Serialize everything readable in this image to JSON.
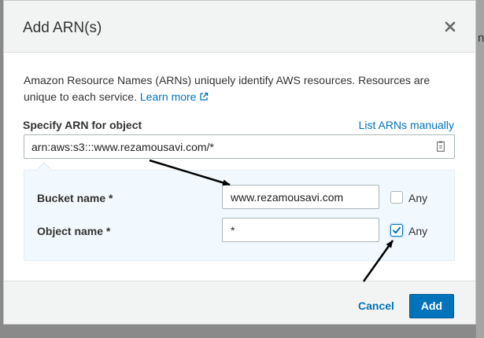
{
  "background": {
    "partial_text": "n J"
  },
  "dialog": {
    "title": "Add ARN(s)",
    "close_icon": "close-icon",
    "description": "Amazon Resource Names (ARNs) uniquely identify AWS resources. Resources are unique to each service.",
    "learn_more_label": "Learn more",
    "learn_more_icon": "external-link-icon"
  },
  "arn_field": {
    "label": "Specify ARN for object",
    "list_manually_label": "List ARNs manually",
    "value": "arn:aws:s3:::www.rezamousavi.com/*",
    "icon": "clipboard-icon"
  },
  "details": {
    "bucket": {
      "label": "Bucket name *",
      "value": "www.rezamousavi.com",
      "any_label": "Any",
      "any_checked": false
    },
    "object": {
      "label": "Object name *",
      "value": "*",
      "any_label": "Any",
      "any_checked": true
    }
  },
  "footer": {
    "cancel_label": "Cancel",
    "add_label": "Add"
  },
  "colors": {
    "accent": "#0073bb",
    "panel": "#f1f8fe",
    "header": "#f2f3f3",
    "annotation_arrows": "#000000"
  }
}
